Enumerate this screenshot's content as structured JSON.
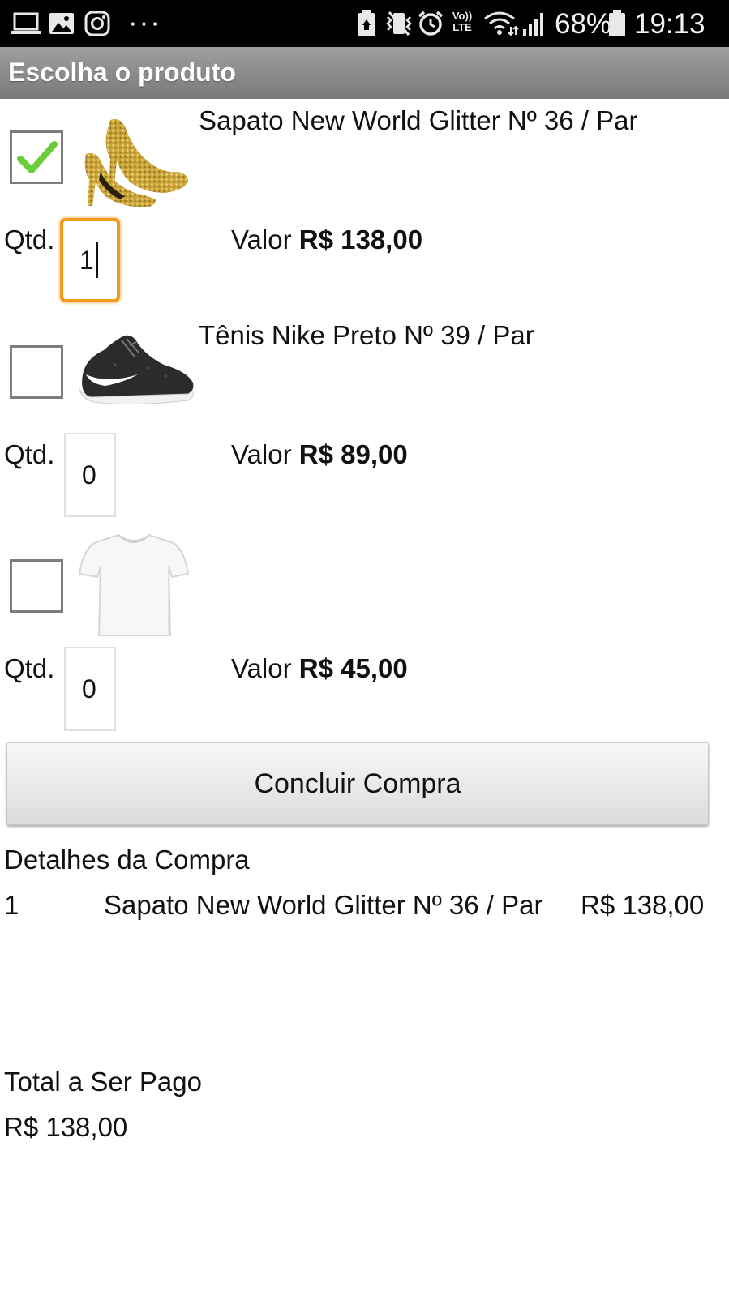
{
  "status_bar": {
    "battery": "68%",
    "time": "19:13",
    "dots": "···",
    "volte_label": "Vo)) LTE",
    "icons": [
      "laptop-icon",
      "image-icon",
      "instagram-icon",
      "more-icon",
      "battery-saver-icon",
      "vibrate-icon",
      "alarm-icon",
      "volte-icon",
      "wifi-icon",
      "signal-icon",
      "battery-icon"
    ]
  },
  "title_bar": {
    "title": "Escolha o produto",
    "color": "#8a8a8a"
  },
  "products": [
    {
      "name": "Sapato New World Glitter Nº 36 / Par",
      "checked": true,
      "image": "gold-glitter-heels",
      "qty_label": "Qtd.",
      "qty": "1",
      "valor_label": "Valor",
      "price": "R$ 138,00"
    },
    {
      "name": "Tênis Nike Preto Nº 39 / Par",
      "checked": false,
      "image": "black-nike-sneaker",
      "qty_label": "Qtd.",
      "qty": "0",
      "valor_label": "Valor",
      "price": "R$ 89,00"
    },
    {
      "name": "",
      "checked": false,
      "image": "white-tshirt",
      "qty_label": "Qtd.",
      "qty": "0",
      "valor_label": "Valor",
      "price": "R$ 45,00"
    }
  ],
  "concluir_button": "Concluir Compra",
  "details": {
    "heading": "Detalhes da Compra",
    "rows": [
      {
        "qty": "1",
        "name": "Sapato New World Glitter Nº 36 / Par",
        "price": "R$ 138,00"
      }
    ]
  },
  "total": {
    "label": "Total a Ser Pago",
    "value": "R$ 138,00"
  },
  "colors": {
    "focus_orange": "#f39a1d",
    "check_green": "#6ccd3a"
  }
}
